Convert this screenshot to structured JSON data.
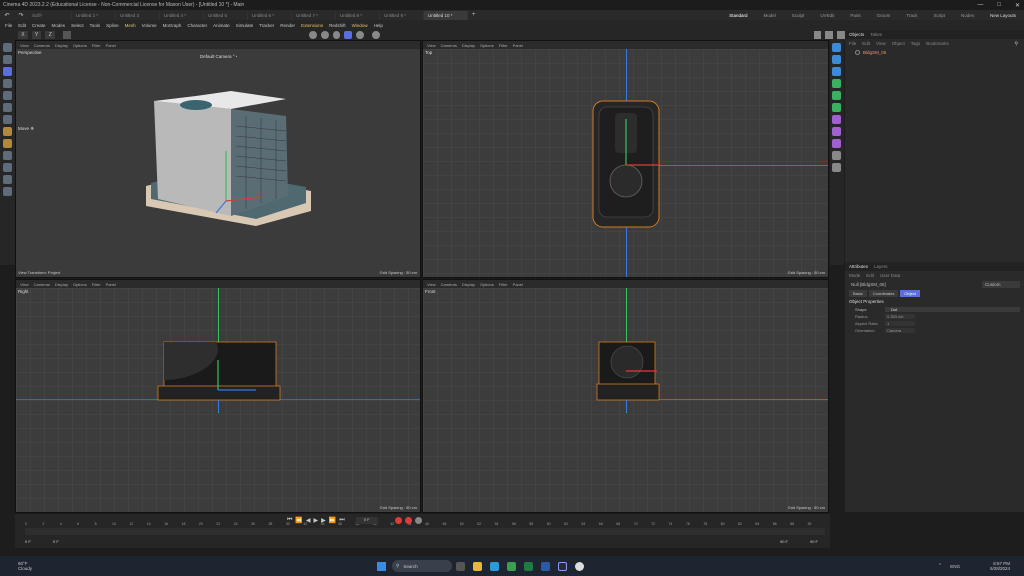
{
  "window": {
    "title": "Cinema 4D 2023.2.2 (Educational License - Non-Commercial License for Maxon User) - [Untitled 10 *] - Main"
  },
  "tabs": [
    {
      "label": "Scifi*",
      "active": false
    },
    {
      "label": "Untitled 2 *",
      "active": false
    },
    {
      "label": "Untitled 3",
      "active": false
    },
    {
      "label": "Untitled 4 *",
      "active": false
    },
    {
      "label": "Untitled 5",
      "active": false
    },
    {
      "label": "Untitled 6 *",
      "active": false
    },
    {
      "label": "Untitled 7 *",
      "active": false
    },
    {
      "label": "Untitled 8 *",
      "active": false
    },
    {
      "label": "Untitled 9 *",
      "active": false
    },
    {
      "label": "Untitled 10 *",
      "active": true
    }
  ],
  "layouts": {
    "items": [
      "Standard",
      "Model",
      "Sculpt",
      "UVEdit",
      "Paint",
      "Groom",
      "Track",
      "Script",
      "Nodes"
    ],
    "active": "Standard",
    "new_layouts": "New Layouts"
  },
  "menu": [
    "File",
    "Edit",
    "Create",
    "Modes",
    "Select",
    "Tools",
    "Spline",
    "Mesh",
    "Volume",
    "MoGraph",
    "Character",
    "Animate",
    "Simulate",
    "Tracker",
    "Render",
    "Extensions",
    "Redshift",
    "Window",
    "Help"
  ],
  "axis_toolbar": [
    "X",
    "Y",
    "Z"
  ],
  "viewport_menu": [
    "View",
    "Cameras",
    "Display",
    "Options",
    "Filter",
    "Panel"
  ],
  "viewports": {
    "perspective": {
      "name": "Perspective",
      "camera": "Default Camera °◔",
      "footer_left": "View Transform: Project",
      "grid": "Grid Spacing : 50 cm",
      "tool_label": "Move ✵"
    },
    "top": {
      "name": "Top",
      "grid": "Grid Spacing : 50 cm"
    },
    "right": {
      "name": "Right",
      "grid": "Grid Spacing : 50 cm"
    },
    "front": {
      "name": "Front",
      "grid": "Grid Spacing : 50 cm"
    }
  },
  "objects_panel": {
    "tabs": [
      "Objects",
      "Takes"
    ],
    "menu": [
      "File",
      "Edit",
      "View",
      "Object",
      "Tags",
      "Bookmarks"
    ],
    "object": "BldgSM_06"
  },
  "attributes_panel": {
    "tabs": [
      "Attributes",
      "Layers"
    ],
    "menu": [
      "Mode",
      "Edit",
      "User Data"
    ],
    "title": "Null [BldgSM_06]",
    "preset": "Custom",
    "subtabs": [
      "Basic",
      "Coordinates",
      "Object"
    ],
    "section": "Object Properties",
    "fields": [
      {
        "label": "Shape",
        "value": "Dot"
      },
      {
        "label": "Radius",
        "value": "0.393 cm"
      },
      {
        "label": "Aspect Ratio",
        "value": "1"
      },
      {
        "label": "Orientation",
        "value": "Camera"
      }
    ]
  },
  "timeline": {
    "ticks": [
      "0",
      "2",
      "4",
      "6",
      "8",
      "10",
      "12",
      "14",
      "16",
      "18",
      "20",
      "22",
      "24",
      "26",
      "28",
      "30",
      "32",
      "34",
      "36",
      "38",
      "40",
      "42",
      "44",
      "46",
      "48",
      "50",
      "52",
      "54",
      "56",
      "58",
      "60",
      "62",
      "64",
      "66",
      "68",
      "70",
      "72",
      "74",
      "76",
      "78",
      "80",
      "82",
      "84",
      "86",
      "88",
      "90"
    ],
    "start": "0 F",
    "start2": "0 F",
    "end": "90 F",
    "end2": "90 F",
    "current": "0 F"
  },
  "taskbar": {
    "weather_temp": "60°F",
    "weather_desc": "Cloudy",
    "search": "Search",
    "lang": "ENG",
    "time": "6:57 PM",
    "date": "5/28/2024"
  },
  "colors": {
    "accent": "#5b6ee1",
    "highlight": "#e8c060",
    "axis_red": "#e03a3a",
    "axis_green": "#3ac05a",
    "axis_blue": "#3a7ae0"
  }
}
